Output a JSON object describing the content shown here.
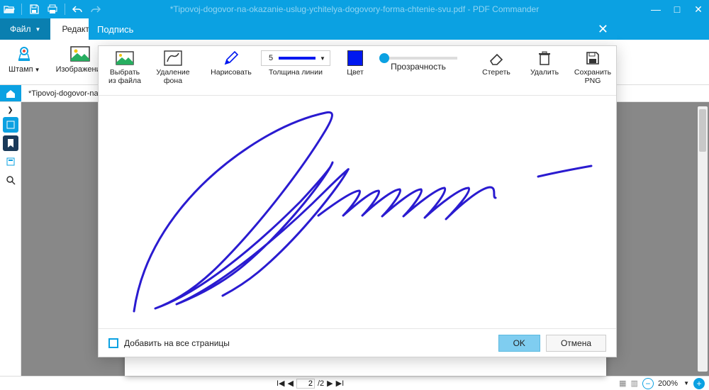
{
  "window": {
    "title": "*Tipovoj-dogovor-na-okazanie-uslug-ychitelya-dogovory-forma-chtenie-svu.pdf - PDF Commander",
    "min": "—",
    "restore": "□",
    "close": "✕"
  },
  "ribbonTabs": {
    "file": "Файл",
    "editor": "Редактор"
  },
  "ribbon": {
    "stamp": "Штамп",
    "image": "Изображение"
  },
  "docTab": "*Tipovoj-dogovor-na-ok...",
  "status": {
    "page": "2",
    "totalPages": "/2",
    "zoom": "200%"
  },
  "dialog": {
    "title": "Подпись",
    "tools": {
      "fromFile": "Выбрать\nиз файла",
      "removeBg": "Удаление\nфона",
      "draw": "Нарисовать",
      "lineWidth": {
        "label": "Толщина линии",
        "value": "5"
      },
      "color": "Цвет",
      "opacity": "Прозрачность",
      "erase": "Стереть",
      "delete": "Удалить",
      "savePng": "Сохранить\nPNG"
    },
    "footer": {
      "addAll": "Добавить на все страницы",
      "ok": "OK",
      "cancel": "Отмена"
    }
  }
}
